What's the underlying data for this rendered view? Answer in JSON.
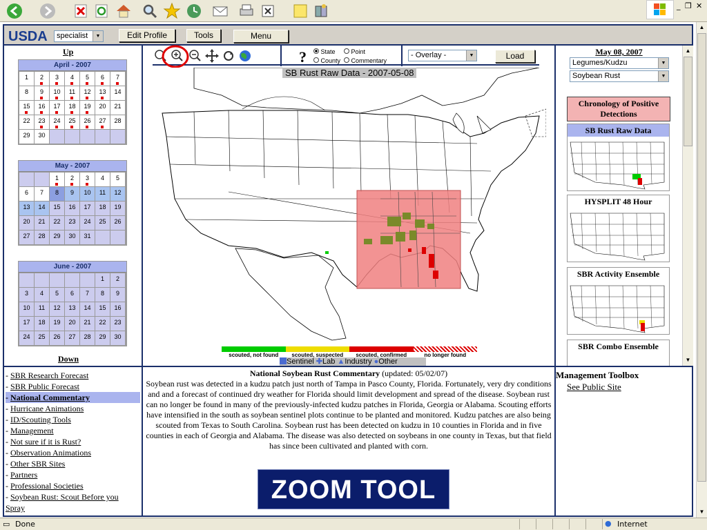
{
  "status_bar": {
    "done": "Done",
    "zone": "Internet"
  },
  "header": {
    "logo": "USDA",
    "role_select": "specialist",
    "edit_profile": "Edit Profile",
    "tools": "Tools",
    "menu": "Menu"
  },
  "calendar": {
    "up": "Up",
    "down": "Down",
    "months": [
      {
        "title": "April - 2007",
        "cells": [
          [
            "1",
            ""
          ],
          [
            "2",
            "r"
          ],
          [
            "3",
            "r"
          ],
          [
            "4",
            "r"
          ],
          [
            "5",
            "r"
          ],
          [
            "6",
            "r"
          ],
          [
            "7",
            "r"
          ],
          [
            "8",
            ""
          ],
          [
            "9",
            "r"
          ],
          [
            "10",
            "r"
          ],
          [
            "11",
            "r"
          ],
          [
            "12",
            "r"
          ],
          [
            "13",
            "r"
          ],
          [
            "14",
            ""
          ],
          [
            "15",
            "r"
          ],
          [
            "16",
            "r"
          ],
          [
            "17",
            "r"
          ],
          [
            "18",
            "r"
          ],
          [
            "19",
            "r"
          ],
          [
            "20",
            ""
          ],
          [
            "21",
            ""
          ],
          [
            "22",
            ""
          ],
          [
            "23",
            "r"
          ],
          [
            "24",
            "r"
          ],
          [
            "25",
            "r"
          ],
          [
            "26",
            "r"
          ],
          [
            "27",
            "r"
          ],
          [
            "28",
            ""
          ],
          [
            "29",
            ""
          ],
          [
            "30",
            ""
          ],
          [
            "",
            "e"
          ],
          [
            "",
            "e"
          ],
          [
            "",
            "e"
          ],
          [
            "",
            "e"
          ],
          [
            "",
            "e"
          ]
        ]
      },
      {
        "title": "May - 2007",
        "cells": [
          [
            "",
            "e"
          ],
          [
            "",
            "e"
          ],
          [
            "1",
            "r"
          ],
          [
            "2",
            "r"
          ],
          [
            "3",
            "r"
          ],
          [
            "4",
            ""
          ],
          [
            "5",
            ""
          ],
          [
            "6",
            ""
          ],
          [
            "7",
            ""
          ],
          [
            "8",
            "s"
          ],
          [
            "9",
            "h"
          ],
          [
            "10",
            "h"
          ],
          [
            "11",
            "h"
          ],
          [
            "12",
            "h"
          ],
          [
            "13",
            "h"
          ],
          [
            "14",
            "h"
          ],
          [
            "15",
            "e"
          ],
          [
            "16",
            "e"
          ],
          [
            "17",
            "e"
          ],
          [
            "18",
            "e"
          ],
          [
            "19",
            "e"
          ],
          [
            "20",
            "e"
          ],
          [
            "21",
            "e"
          ],
          [
            "22",
            "e"
          ],
          [
            "23",
            "e"
          ],
          [
            "24",
            "e"
          ],
          [
            "25",
            "e"
          ],
          [
            "26",
            "e"
          ],
          [
            "27",
            "e"
          ],
          [
            "28",
            "e"
          ],
          [
            "29",
            "e"
          ],
          [
            "30",
            "e"
          ],
          [
            "31",
            "e"
          ],
          [
            "",
            "e"
          ],
          [
            "",
            "e"
          ]
        ]
      },
      {
        "title": "June - 2007",
        "cells": [
          [
            "",
            "e"
          ],
          [
            "",
            "e"
          ],
          [
            "",
            "e"
          ],
          [
            "",
            "e"
          ],
          [
            "",
            "e"
          ],
          [
            "1",
            "e"
          ],
          [
            "2",
            "e"
          ],
          [
            "3",
            "e"
          ],
          [
            "4",
            "e"
          ],
          [
            "5",
            "e"
          ],
          [
            "6",
            "e"
          ],
          [
            "7",
            "e"
          ],
          [
            "8",
            "e"
          ],
          [
            "9",
            "e"
          ],
          [
            "10",
            "e"
          ],
          [
            "11",
            "e"
          ],
          [
            "12",
            "e"
          ],
          [
            "13",
            "e"
          ],
          [
            "14",
            "e"
          ],
          [
            "15",
            "e"
          ],
          [
            "16",
            "e"
          ],
          [
            "17",
            "e"
          ],
          [
            "18",
            "e"
          ],
          [
            "19",
            "e"
          ],
          [
            "20",
            "e"
          ],
          [
            "21",
            "e"
          ],
          [
            "22",
            "e"
          ],
          [
            "23",
            "e"
          ],
          [
            "24",
            "e"
          ],
          [
            "25",
            "e"
          ],
          [
            "26",
            "e"
          ],
          [
            "27",
            "e"
          ],
          [
            "28",
            "e"
          ],
          [
            "29",
            "e"
          ],
          [
            "30",
            "e"
          ]
        ]
      }
    ]
  },
  "map": {
    "help": "?",
    "view_options": {
      "state": "State",
      "point": "Point",
      "county": "County",
      "commentary": "Commentary"
    },
    "overlay_select": "- Overlay -",
    "load": "Load",
    "title": "SB Rust Raw Data - 2007-05-08",
    "legend": {
      "not_found": "scouted, not found",
      "suspected": "scouted, suspected",
      "confirmed": "scouted, confirmed",
      "no_longer": "no longer found",
      "sentinel": "Sentinel",
      "lab": "Lab",
      "industry": "Industry",
      "other": "Other"
    },
    "colors": {
      "not_found": "#00cc00",
      "suspected": "#eedd00",
      "confirmed": "#dd0000",
      "zoom_box": "#f08080",
      "kudzu": "#7a8a2a"
    }
  },
  "right_panel": {
    "date": "May 08, 2007",
    "host_select": "Legumes/Kudzu",
    "disease_select": "Soybean Rust",
    "chronology": "Chronology of Positive Detections",
    "cards": [
      {
        "title": "SB Rust Raw Data"
      },
      {
        "title": "HYSPLIT 48 Hour"
      },
      {
        "title": "SBR Activity Ensemble"
      },
      {
        "title": "SBR Combo Ensemble"
      }
    ]
  },
  "nav": {
    "items": [
      {
        "label": "SBR Research Forecast",
        "active": false
      },
      {
        "label": "SBR Public Forecast",
        "active": false
      },
      {
        "label": "National Commentary",
        "active": true
      },
      {
        "label": "Hurricane Animations",
        "active": false
      },
      {
        "label": "ID/Scouting Tools",
        "active": false
      },
      {
        "label": "Management",
        "active": false
      },
      {
        "label": "Not sure if it is Rust?",
        "active": false
      },
      {
        "label": "Observation Animations",
        "active": false
      },
      {
        "label": "Other SBR Sites",
        "active": false
      },
      {
        "label": "Partners",
        "active": false
      },
      {
        "label": "Professional Societies",
        "active": false
      },
      {
        "label": "Soybean Rust: Scout Before you",
        "active": false
      }
    ],
    "last_line": "Spray"
  },
  "commentary": {
    "title": "National Soybean Rust Commentary",
    "updated": " (updated: 05/02/07)",
    "body": "Soybean rust was detected in a kudzu patch just north of Tampa in Pasco County, Florida. Fortunately, very dry conditions and and a forecast of continued dry weather for Florida should limit development and spread of the disease. Soybean rust can no longer be found in many of the previously-infected kudzu patches in Florida, Georgia or Alabama. Scouting efforts have intensified in the south as soybean sentinel plots continue to be planted and monitored. Kudzu patches are also being scouted from Texas to South Carolina. Soybean rust has been detected on kudzu in 10 counties in Florida and in five counties in each of Georgia and Alabama. The disease was also detected on soybeans in one county in Texas, but that field has since been cultivated and planted with corn.",
    "zoom_banner": "ZOOM TOOL"
  },
  "toolbox": {
    "title": "Management Toolbox",
    "link": "See Public Site"
  }
}
